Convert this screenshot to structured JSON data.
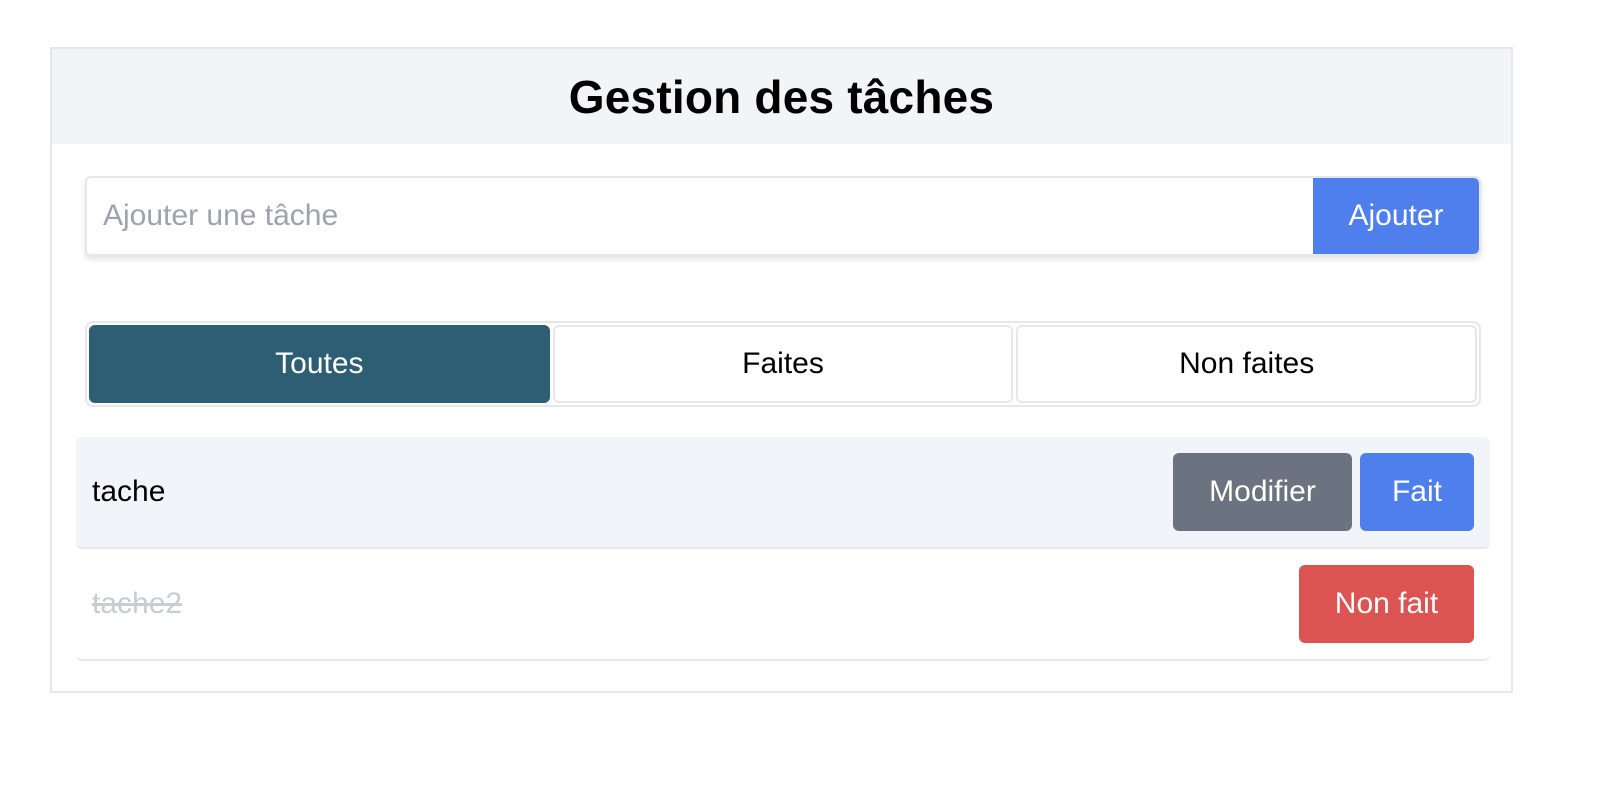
{
  "header": {
    "title": "Gestion des tâches"
  },
  "add_form": {
    "placeholder": "Ajouter une tâche",
    "value": "",
    "button_label": "Ajouter"
  },
  "filters": [
    {
      "label": "Toutes",
      "active": true
    },
    {
      "label": "Faites",
      "active": false
    },
    {
      "label": "Non faites",
      "active": false
    }
  ],
  "tasks": [
    {
      "label": "tache",
      "done": false,
      "edit_label": "Modifier",
      "toggle_label": "Fait"
    },
    {
      "label": "tache2",
      "done": true,
      "toggle_label": "Non fait"
    }
  ],
  "colors": {
    "primary": "#4e7fec",
    "active_filter": "#2e5e74",
    "edit": "#6b7280",
    "undo": "#dc5452",
    "header_bg": "#f3f4f6"
  }
}
